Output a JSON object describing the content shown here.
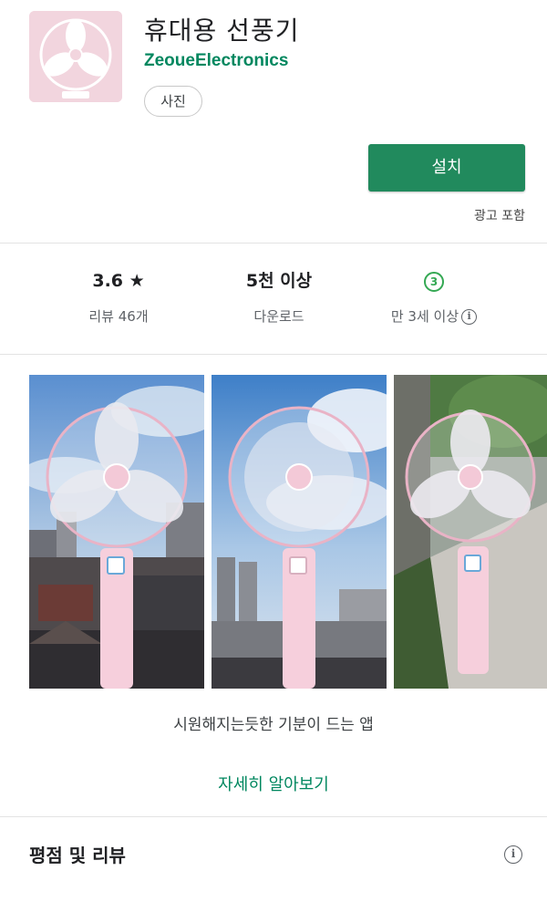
{
  "app": {
    "title": "휴대용 선풍기",
    "developer": "ZeoueElectronics",
    "category_chip": "사진",
    "icon": "fan-icon",
    "accent_color": "#01875f",
    "icon_bg_color": "#f2d5de"
  },
  "install": {
    "label": "설치",
    "ad_notice": "광고 포함",
    "color": "#218a5d"
  },
  "stats": {
    "rating": {
      "value": "3.6 ★",
      "label": "리뷰 46개"
    },
    "downloads": {
      "value": "5천 이상",
      "label": "다운로드"
    },
    "age": {
      "badge": "3",
      "label": "만 3세 이상",
      "icon": "info-icon"
    }
  },
  "screenshots": [
    {
      "name": "screenshot-1"
    },
    {
      "name": "screenshot-2"
    },
    {
      "name": "screenshot-3"
    }
  ],
  "description": "시원해지는듯한 기분이 드는 앱",
  "more_link": "자세히 알아보기",
  "ratings_section": {
    "title": "평점 및 리뷰",
    "icon": "info-icon"
  }
}
